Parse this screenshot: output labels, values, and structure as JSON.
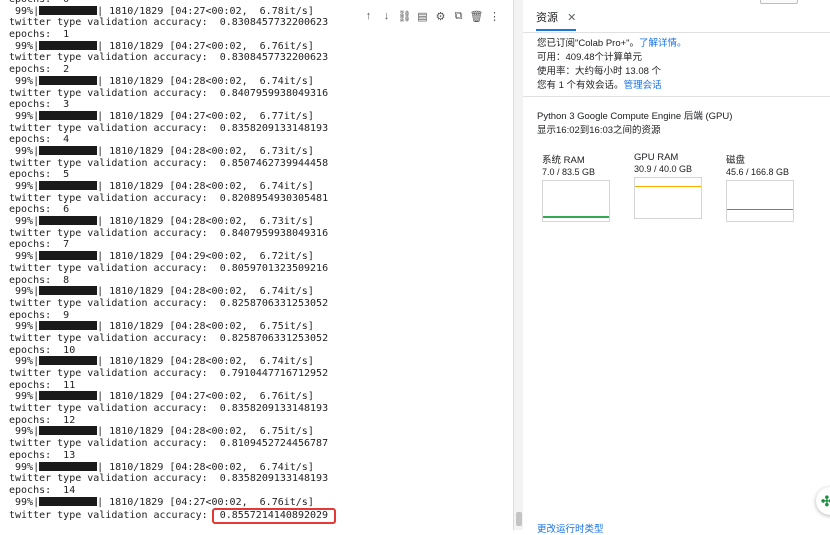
{
  "output": {
    "bar_percent": " 99%|",
    "lines": [
      {
        "kind": "text",
        "text": "epochs:  0"
      },
      {
        "kind": "progress",
        "stats": "| 1810/1829 [04:27<00:02,  6.78it/s]"
      },
      {
        "kind": "text",
        "text": "twitter type validation accuracy:  0.8308457732200623"
      },
      {
        "kind": "text",
        "text": "epochs:  1"
      },
      {
        "kind": "progress",
        "stats": "| 1810/1829 [04:27<00:02,  6.76it/s]"
      },
      {
        "kind": "text",
        "text": "twitter type validation accuracy:  0.8308457732200623"
      },
      {
        "kind": "text",
        "text": "epochs:  2"
      },
      {
        "kind": "progress",
        "stats": "| 1810/1829 [04:28<00:02,  6.74it/s]"
      },
      {
        "kind": "text",
        "text": "twitter type validation accuracy:  0.8407959938049316"
      },
      {
        "kind": "text",
        "text": "epochs:  3"
      },
      {
        "kind": "progress",
        "stats": "| 1810/1829 [04:27<00:02,  6.77it/s]"
      },
      {
        "kind": "text",
        "text": "twitter type validation accuracy:  0.8358209133148193"
      },
      {
        "kind": "text",
        "text": "epochs:  4"
      },
      {
        "kind": "progress",
        "stats": "| 1810/1829 [04:28<00:02,  6.73it/s]"
      },
      {
        "kind": "text",
        "text": "twitter type validation accuracy:  0.8507462739944458"
      },
      {
        "kind": "text",
        "text": "epochs:  5"
      },
      {
        "kind": "progress",
        "stats": "| 1810/1829 [04:28<00:02,  6.74it/s]"
      },
      {
        "kind": "text",
        "text": "twitter type validation accuracy:  0.8208954930305481"
      },
      {
        "kind": "text",
        "text": "epochs:  6"
      },
      {
        "kind": "progress",
        "stats": "| 1810/1829 [04:28<00:02,  6.73it/s]"
      },
      {
        "kind": "text",
        "text": "twitter type validation accuracy:  0.8407959938049316"
      },
      {
        "kind": "text",
        "text": "epochs:  7"
      },
      {
        "kind": "progress",
        "stats": "| 1810/1829 [04:29<00:02,  6.72it/s]"
      },
      {
        "kind": "text",
        "text": "twitter type validation accuracy:  0.8059701323509216"
      },
      {
        "kind": "text",
        "text": "epochs:  8"
      },
      {
        "kind": "progress",
        "stats": "| 1810/1829 [04:28<00:02,  6.74it/s]"
      },
      {
        "kind": "text",
        "text": "twitter type validation accuracy:  0.8258706331253052"
      },
      {
        "kind": "text",
        "text": "epochs:  9"
      },
      {
        "kind": "progress",
        "stats": "| 1810/1829 [04:28<00:02,  6.75it/s]"
      },
      {
        "kind": "text",
        "text": "twitter type validation accuracy:  0.8258706331253052"
      },
      {
        "kind": "text",
        "text": "epochs:  10"
      },
      {
        "kind": "progress",
        "stats": "| 1810/1829 [04:28<00:02,  6.74it/s]"
      },
      {
        "kind": "text",
        "text": "twitter type validation accuracy:  0.7910447716712952"
      },
      {
        "kind": "text",
        "text": "epochs:  11"
      },
      {
        "kind": "progress",
        "stats": "| 1810/1829 [04:27<00:02,  6.76it/s]"
      },
      {
        "kind": "text",
        "text": "twitter type validation accuracy:  0.8358209133148193"
      },
      {
        "kind": "text",
        "text": "epochs:  12"
      },
      {
        "kind": "progress",
        "stats": "| 1810/1829 [04:28<00:02,  6.75it/s]"
      },
      {
        "kind": "text",
        "text": "twitter type validation accuracy:  0.8109452724456787"
      },
      {
        "kind": "text",
        "text": "epochs:  13"
      },
      {
        "kind": "progress",
        "stats": "| 1810/1829 [04:28<00:02,  6.74it/s]"
      },
      {
        "kind": "text",
        "text": "twitter type validation accuracy:  0.8358209133148193"
      },
      {
        "kind": "text",
        "text": "epochs:  14"
      },
      {
        "kind": "progress",
        "stats": "| 1810/1829 [04:27<00:02,  6.76it/s]"
      },
      {
        "kind": "highlight",
        "prefix": "twitter type validation accuracy:",
        "value": "0.8557214140892029"
      }
    ]
  },
  "cell_toolbar": {
    "icons": [
      "arrow-up-icon",
      "arrow-down-icon",
      "link-icon",
      "comment-icon",
      "settings-icon",
      "mirror-cell-icon",
      "delete-icon",
      "more-vert-icon"
    ],
    "glyphs": [
      "↑",
      "↓",
      "⛓",
      "▤",
      "⚙",
      "⧉",
      "🗑",
      "⋮"
    ]
  },
  "resources": {
    "tab_label": "资源",
    "close_glyph": "✕",
    "subscription_text": "您已订阅\"Colab Pro+\"。",
    "learn_more": "了解详情。",
    "available": "可用：409.48个计算单元",
    "usage_rate": "使用率：大约每小时 13.08 个",
    "sessions_text": "您有 1 个有效会话。",
    "manage_sessions": "管理会话",
    "backend": "Python 3 Google Compute Engine 后端 (GPU)",
    "time_range": "显示16:02到16:03之间的资源",
    "stats": [
      {
        "name": "系统 RAM",
        "value": "7.0 / 83.5 GB",
        "fraction": 0.084,
        "color": "#34a853"
      },
      {
        "name": "GPU RAM",
        "value": "30.9 / 40.0 GB",
        "fraction": 0.7725,
        "color": "#f9ab00"
      },
      {
        "name": "磁盘",
        "value": "45.6 / 166.8 GB",
        "fraction": 0.273,
        "color": "#34a853"
      }
    ],
    "bottom_link": "更改运行时类型"
  }
}
